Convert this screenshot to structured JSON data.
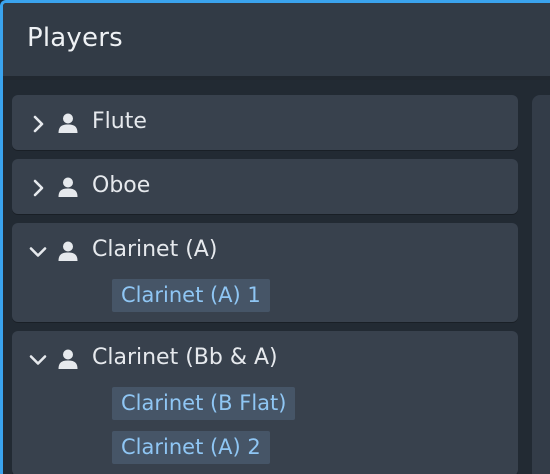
{
  "panel": {
    "title": "Players"
  },
  "players": [
    {
      "name": "Flute",
      "expanded": false,
      "instruments": []
    },
    {
      "name": "Oboe",
      "expanded": false,
      "instruments": []
    },
    {
      "name": "Clarinet (A)",
      "expanded": true,
      "instruments": [
        "Clarinet (A) 1"
      ]
    },
    {
      "name": "Clarinet (Bb & A)",
      "expanded": true,
      "instruments": [
        "Clarinet (B Flat)",
        "Clarinet (A) 2"
      ]
    }
  ],
  "colors": {
    "accent": "#3aa3ee",
    "chip_text": "#8fc6f4",
    "chip_bg": "#465567",
    "card_bg": "#38414d",
    "header_bg": "#323b46"
  },
  "icons": {
    "collapsed": "chevron-right-icon",
    "expanded": "chevron-down-icon",
    "player": "person-icon"
  }
}
